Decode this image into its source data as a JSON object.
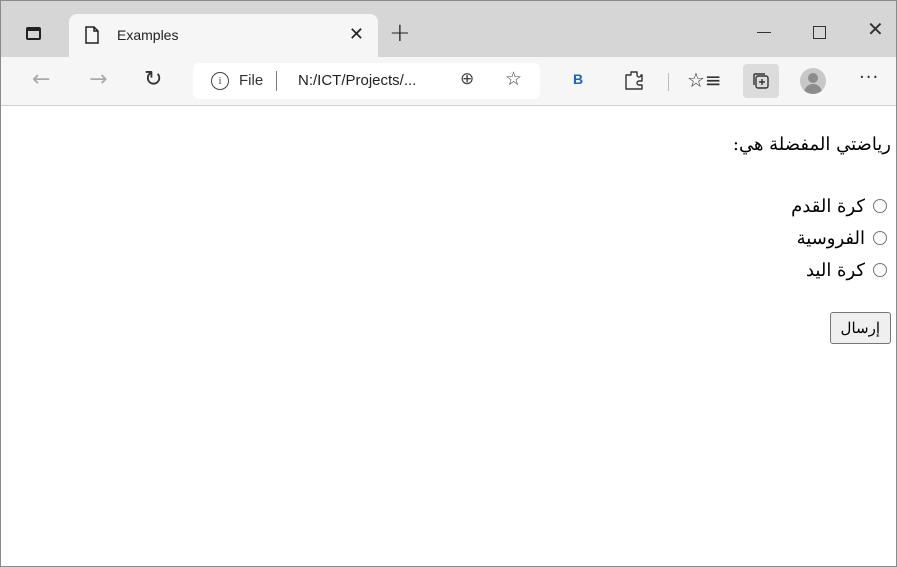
{
  "browser": {
    "tab": {
      "title": "Examples"
    },
    "address": {
      "scheme_label": "File",
      "url": "N:/ICT/Projects/..."
    },
    "bing_label": "B"
  },
  "form": {
    "question": "رياضتي المفضلة هي:",
    "options": [
      "كرة القدم",
      "الفروسية",
      "كرة اليد"
    ],
    "submit_label": "إرسال"
  }
}
